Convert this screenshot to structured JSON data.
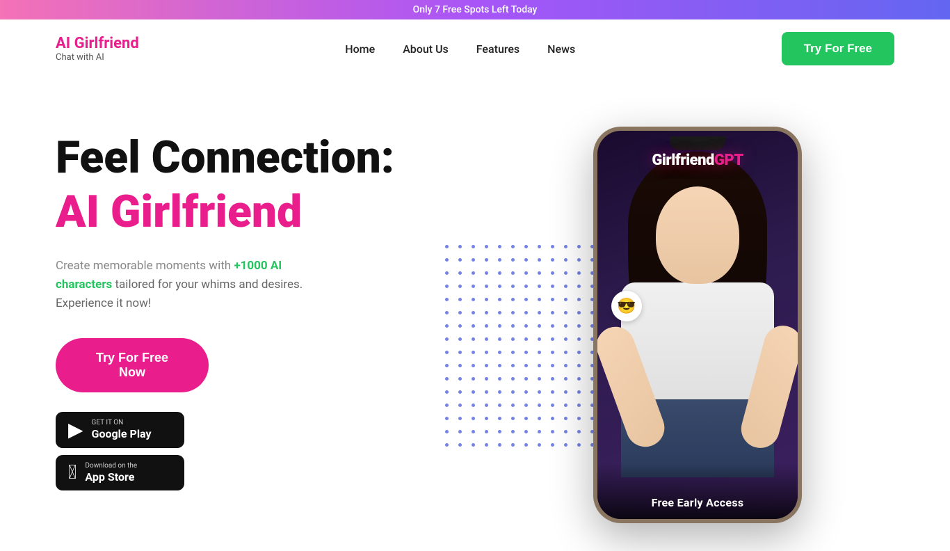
{
  "banner": {
    "text": "Only 7 Free Spots Left Today"
  },
  "navbar": {
    "logo_name": "AI Girlfriend",
    "logo_tagline": "Chat with AI",
    "nav_items": [
      {
        "label": "Home",
        "href": "#"
      },
      {
        "label": "About Us",
        "href": "#"
      },
      {
        "label": "Features",
        "href": "#"
      },
      {
        "label": "News",
        "href": "#"
      }
    ],
    "cta_label": "Try For Free"
  },
  "hero": {
    "title_line1": "Feel Connection:",
    "title_line2": "AI Girlfriend",
    "desc_prefix": "Create memorable moments with ",
    "desc_highlight": "+1000 AI characters",
    "desc_suffix": " tailored for your whims and desires. Experience it now!",
    "cta_label": "Try For Free Now",
    "google_play": {
      "sub": "GET IT ON",
      "main": "Google Play"
    },
    "app_store": {
      "sub": "Download on the",
      "main": "App Store"
    }
  },
  "phone": {
    "app_name_white": "Girlfriend",
    "app_name_pink": "GPT",
    "emoji": "😎",
    "bottom_text": "Free Early Access"
  },
  "colors": {
    "pink": "#e91e8c",
    "green": "#22c55e",
    "dark": "#111111",
    "dot_blue": "#3b4fd8"
  }
}
